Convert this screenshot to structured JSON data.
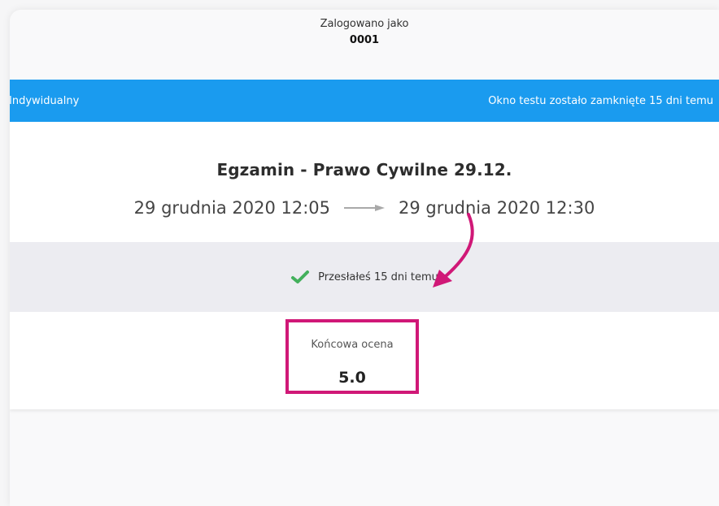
{
  "header": {
    "logged_in_label": "Zalogowano jako",
    "user_id": "0001"
  },
  "bar": {
    "mode": "Indywidualny",
    "status": "Okno testu zostało zamknięte 15 dni temu"
  },
  "exam": {
    "title": "Egzamin - Prawo Cywilne 29.12.",
    "start": "29 grudnia 2020 12:05",
    "end": "29 grudnia 2020 12:30",
    "submitted": "Przesłałeś 15 dni temu",
    "final_grade_label": "Końcowa ocena",
    "final_grade": "5.0"
  },
  "colors": {
    "bar": "#1a9bef",
    "highlight": "#d01877",
    "check": "#43b05c"
  },
  "icons": {
    "check": "check-icon",
    "arrow": "right-arrow-icon",
    "annotation": "curved-arrow-icon"
  }
}
